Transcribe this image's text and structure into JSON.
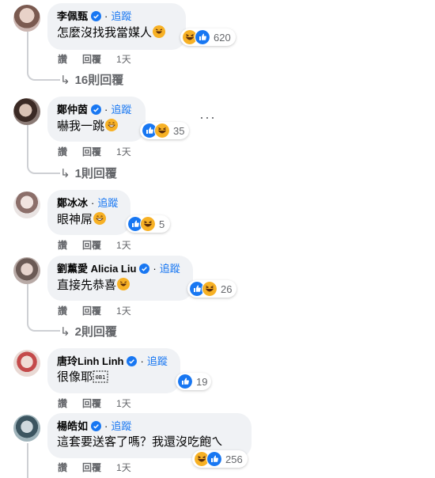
{
  "follow_label": "追蹤",
  "actions": {
    "like": "讚",
    "reply": "回覆"
  },
  "comments": [
    {
      "name": "李佩甄",
      "verified": true,
      "text": "怎麼沒找我當媒人",
      "reaction_count": "620",
      "time": "1天",
      "replies": "16則回覆"
    },
    {
      "name": "鄭仲茵",
      "verified": true,
      "text": "嚇我一跳",
      "reaction_count": "35",
      "time": "1天",
      "replies": "1則回覆"
    },
    {
      "name": "鄭冰冰",
      "verified": false,
      "text": "眼神屌",
      "reaction_count": "5",
      "time": "1天",
      "replies": ""
    },
    {
      "name": "劉薰愛 Alicia Liu",
      "verified": true,
      "text": "直接先恭喜",
      "reaction_count": "26",
      "time": "1天",
      "replies": "2則回覆"
    },
    {
      "name": "唐玲Linh Linh",
      "verified": true,
      "text": "很像耶",
      "reaction_count": "19",
      "time": "1天",
      "replies": ""
    },
    {
      "name": "楊皓如",
      "verified": true,
      "text": "這套要送客了嗎？我還沒吃飽ㄟ",
      "reaction_count": "256",
      "time": "1天",
      "replies": ""
    }
  ],
  "colors": {
    "accent": "#1877f2",
    "bubble": "#f0f2f5",
    "muted": "#65676b",
    "haha": "#f7b125"
  },
  "icons": [
    "verified-badge-icon",
    "like-reaction-icon",
    "haha-reaction-icon",
    "reply-arrow-icon",
    "more-options-icon"
  ]
}
